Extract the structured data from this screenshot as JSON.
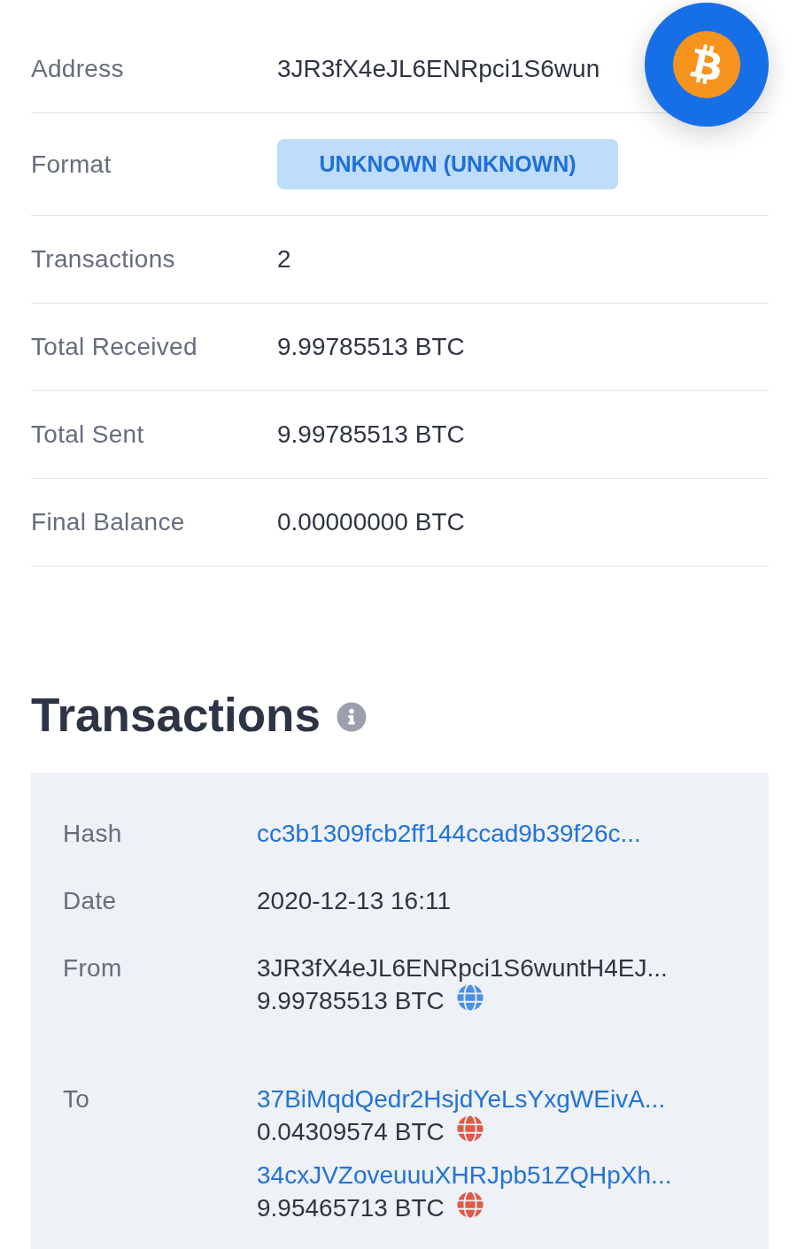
{
  "summary": {
    "rows": [
      {
        "label": "Address",
        "kind": "text",
        "value": "3JR3fX4eJL6ENRpci1S6wun"
      },
      {
        "label": "Format",
        "kind": "badge",
        "value": "UNKNOWN (UNKNOWN)"
      },
      {
        "label": "Transactions",
        "kind": "text",
        "value": "2"
      },
      {
        "label": "Total Received",
        "kind": "text",
        "value": "9.99785513 BTC"
      },
      {
        "label": "Total Sent",
        "kind": "text",
        "value": "9.99785513 BTC"
      },
      {
        "label": "Final Balance",
        "kind": "text",
        "value": "0.00000000 BTC"
      }
    ]
  },
  "transactions": {
    "title": "Transactions",
    "items": [
      {
        "hash": {
          "label": "Hash",
          "value": "cc3b1309fcb2ff144ccad9b39f26c..."
        },
        "date": {
          "label": "Date",
          "value": "2020-12-13 16:11"
        },
        "from": {
          "label": "From",
          "entries": [
            {
              "address": "3JR3fX4eJL6ENRpci1S6wuntH4EJ...",
              "linked": false,
              "amount": "9.99785513 BTC",
              "color": "#4a8fe8"
            }
          ]
        },
        "to": {
          "label": "To",
          "entries": [
            {
              "address": "37BiMqdQedr2HsjdYeLsYxgWEivA...",
              "linked": true,
              "amount": "0.04309574 BTC",
              "color": "#e05a47"
            },
            {
              "address": "34cxJVZoveuuuXHRJpb51ZQHpXh...",
              "linked": true,
              "amount": "9.95465713 BTC",
              "color": "#e05a47"
            }
          ]
        }
      }
    ]
  }
}
